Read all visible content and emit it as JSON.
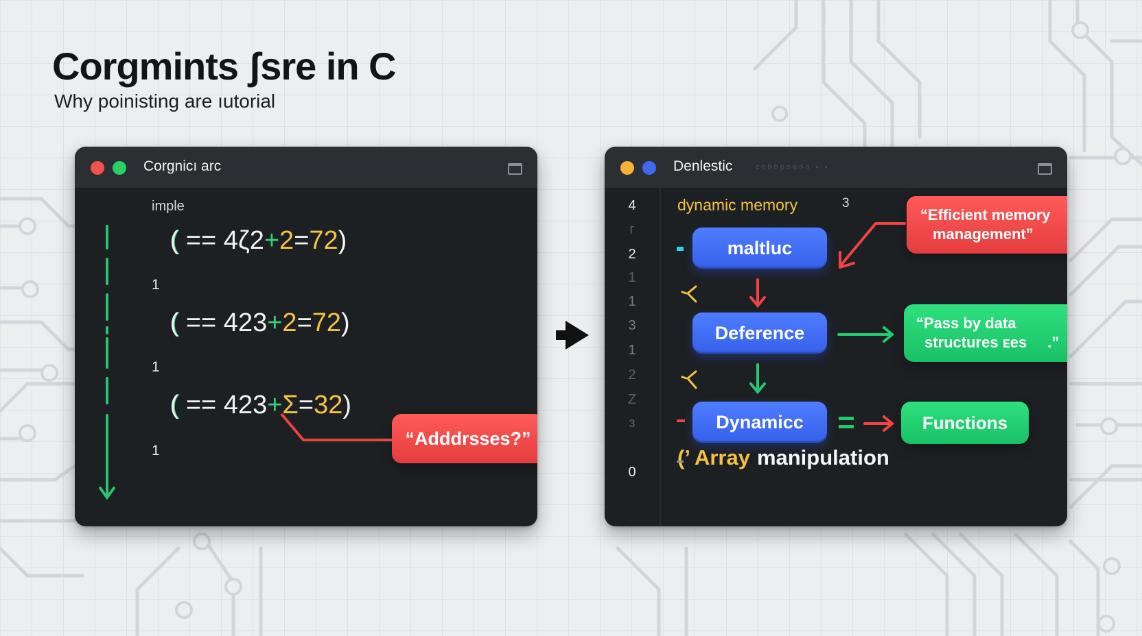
{
  "header": {
    "title": "Corgmints ʃsre in C",
    "subtitle": "Why poinisting are ıutorial"
  },
  "left_window": {
    "title": "Corgnicı arc",
    "label": "imple",
    "lines": [
      {
        "open": "( == 4ζ2",
        "plus": "+",
        "two": "2",
        "eq": "=",
        "res": "72",
        "close": ")"
      },
      {
        "open": "( == 423",
        "plus": "+",
        "two": "2",
        "eq": "=",
        "res": "72",
        "close": ")"
      },
      {
        "open": "( == 423",
        "plus": "+",
        "two": "Σ",
        "eq": "=",
        "res": "32",
        "close": ")"
      }
    ],
    "line_numbers": [
      "1",
      "1",
      "1"
    ],
    "callout": "“Adddrsses?”"
  },
  "right_window": {
    "title": "Denlestic",
    "faint_title": "cobbpoaoo • •",
    "gutter": [
      "4",
      "г",
      "2",
      "1",
      "1",
      "3",
      "1",
      "2",
      "Z",
      "з",
      "0"
    ],
    "heading": "dynamic memory",
    "heading_num": "3",
    "nodes": {
      "malloc": "maltluc",
      "deference": "Deference",
      "dynamic": "Dynamicc"
    },
    "callouts": {
      "efficient": [
        "“Efficient memory",
        "management”"
      ],
      "pass": [
        "“Pass by data",
        "structures ᴇes",
        ".”"
      ],
      "functions": "Functions"
    },
    "array": {
      "prefix": "(’",
      "highlight": "Array",
      "rest": "manipulation"
    }
  },
  "colors": {
    "red": "#e8453f",
    "green": "#22c96f",
    "blue": "#3d68f0",
    "yellow": "#f5c342",
    "dark_window": "#1d2023",
    "dot_red": "#f0524c",
    "dot_green": "#2bcf68",
    "dot_orange": "#f5b13a",
    "dot_blue": "#4169ef"
  },
  "icons": [
    "arrow-right-icon",
    "down-arrow-icon",
    "bracket-icon",
    "equals-icon"
  ]
}
